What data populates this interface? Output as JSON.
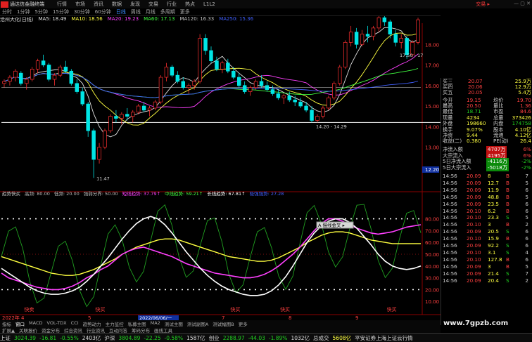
{
  "titlebar": {
    "app": "通达信金融终端",
    "menus": [
      "行情",
      "市场",
      "资讯",
      "数据",
      "发现",
      "交易",
      "行业",
      "热点",
      "L1L2"
    ],
    "trade": "交易 ▸",
    "window_buttons": "— ▢ ✕"
  },
  "periods": [
    "分时",
    "1分钟",
    "5分钟",
    "15分钟",
    "30分钟",
    "60分钟",
    "日线",
    "周线",
    "月线",
    "多周期",
    "更多"
  ],
  "active_period": "日线",
  "stock_name": "沧州大化(日线)",
  "ma_legend": [
    {
      "text": "MA5: 18.49",
      "color": "#e0e0e0"
    },
    {
      "text": "MA10: 18.56",
      "color": "#ffff40"
    },
    {
      "text": "MA20: 19.23",
      "color": "#ff40ff"
    },
    {
      "text": "MA60: 17.13",
      "color": "#40ff40"
    },
    {
      "text": "MA120: 16.33",
      "color": "#c0c0c0"
    },
    {
      "text": "MA250: 15.36",
      "color": "#4060ff"
    }
  ],
  "price_axis": [
    "18.00",
    "17.00",
    "16.00",
    "15.00",
    "14.00",
    "13.00",
    "12.20"
  ],
  "price_annotations": {
    "high": "17.50 - 17",
    "mid": "14.20 - 14.29",
    "low": "11.47"
  },
  "indicator_legend": {
    "name": "趋势快买",
    "items": [
      {
        "text": "高频: 80.00",
        "color": "#bbbbbb"
      },
      {
        "text": "低频: 20.00",
        "color": "#bbbbbb"
      },
      {
        "text": "强弱分界: 50.00",
        "color": "#bbbbbb"
      },
      {
        "text": "短线趋势: 37.79↑",
        "color": "#ff40ff"
      },
      {
        "text": "中线趋势: 59.21↑",
        "color": "#40ff40"
      },
      {
        "text": "长线趋势: 67.81↑",
        "color": "#ffffff"
      },
      {
        "text": "极强强势: 27.28",
        "color": "#4060ff"
      }
    ]
  },
  "indicator_axis": [
    "80.00",
    "70.00",
    "60.00",
    "50.00",
    "40.00",
    "30.00",
    "20.00",
    "10.00"
  ],
  "indicator_labels": {
    "buy": "快买",
    "sell": "快卖",
    "tooltip": "A 慢线金叉 ▸"
  },
  "date_axis": {
    "start": "2022年",
    "marker": "2022/06/06/一",
    "ticks": [
      "4",
      "5",
      "6",
      "7",
      "8",
      "9"
    ]
  },
  "quote": {
    "ask_rows": [
      {
        "label": "买三",
        "price": "20.07",
        "vol": "25.9万"
      },
      {
        "label": "买四",
        "price": "20.06",
        "vol": "12.9万"
      },
      {
        "label": "买五",
        "price": "20.05",
        "vol": "5.4万"
      }
    ],
    "stats": [
      {
        "l1": "今开",
        "v1": "19.15",
        "l2": "均价",
        "v2": "19.70"
      },
      {
        "l1": "最高",
        "v1": "20.50",
        "l2": "量比",
        "v2": "1.36"
      },
      {
        "l1": "最低",
        "v1": "18.71",
        "l2": "市盈",
        "v2": "84.6"
      },
      {
        "l1": "现量",
        "v1": "4234",
        "l2": "总量",
        "v2": "373426"
      },
      {
        "l1": "外盘",
        "v1": "198660",
        "l2": "内盘",
        "v2": "174758"
      },
      {
        "l1": "换手",
        "v1": "9.07%",
        "l2": "股本",
        "v2": "4.10亿"
      },
      {
        "l1": "净资",
        "v1": "9.44",
        "l2": "流通",
        "v2": "4.12亿"
      },
      {
        "l1": "收益(二)",
        "v1": "0.380",
        "l2": "PE(动)",
        "v2": "26.4"
      }
    ],
    "flows": [
      {
        "label": "净流入额",
        "value": "4707万",
        "pct": "6%"
      },
      {
        "label": "大宗流入",
        "value": "4195万",
        "pct": "6%"
      },
      {
        "label": "5日净流入额",
        "value": "-4116万",
        "pct": "-2%"
      },
      {
        "label": "5日大宗流入",
        "value": "-5018万",
        "pct": "-2%"
      }
    ]
  },
  "ticks": [
    {
      "time": "14:56",
      "price": "20.09",
      "vol": "8",
      "side": "B",
      "n": "7"
    },
    {
      "time": "14:56",
      "price": "20.09",
      "vol": "12.7",
      "side": "B",
      "n": "5"
    },
    {
      "time": "14:56",
      "price": "20.09",
      "vol": "11.9",
      "side": "B",
      "n": "6"
    },
    {
      "time": "14:56",
      "price": "20.09",
      "vol": "48.8",
      "side": "B",
      "n": "5"
    },
    {
      "time": "14:56",
      "price": "20.09",
      "vol": "23.5",
      "side": "B",
      "n": "6"
    },
    {
      "time": "14:56",
      "price": "20.10",
      "vol": "6.2",
      "side": "B",
      "n": "6"
    },
    {
      "time": "14:56",
      "price": "20.10",
      "vol": "23.3",
      "side": "S",
      "n": "5"
    },
    {
      "time": "14:56",
      "price": "20.10",
      "vol": "3",
      "side": "B",
      "n": "2"
    },
    {
      "time": "14:56",
      "price": "20.09",
      "vol": "20.5",
      "side": "S",
      "n": "6"
    },
    {
      "time": "14:56",
      "price": "20.10",
      "vol": "15.9",
      "side": "B",
      "n": "6"
    },
    {
      "time": "14:56",
      "price": "20.09",
      "vol": "92.2",
      "side": "S",
      "n": "6"
    },
    {
      "time": "14:56",
      "price": "20.10",
      "vol": "3.1",
      "side": "S",
      "n": "4"
    },
    {
      "time": "14:56",
      "price": "20.10",
      "vol": "127.8",
      "side": "B",
      "n": "6"
    },
    {
      "time": "14:56",
      "price": "20.09",
      "vol": "3",
      "side": "B",
      "n": "5"
    },
    {
      "time": "14:56",
      "price": "20.09",
      "vol": "21.4",
      "side": "S",
      "n": "7"
    },
    {
      "time": "14:56",
      "price": "20.09",
      "vol": "20.4",
      "side": "S",
      "n": "2"
    }
  ],
  "bottom_tabs": [
    "指标",
    "窗口",
    "MACD",
    "VOL-TDX",
    "CCI",
    "趋势动力",
    "主力监控",
    "私募主图",
    "MA2",
    "测试主图",
    "测试副图A",
    "测试幅图B",
    "更多"
  ],
  "bottom_tabs2": [
    "扩展▲",
    "关联报价",
    "资金分布",
    "综合资讯",
    "行业资讯",
    "互动问答",
    "筹码分布",
    "画线工具"
  ],
  "status": {
    "sh_label": "上证",
    "sh_val": "3024.39",
    "sh_chg": "-16.81",
    "sh_pct": "-0.55%",
    "sh_amt": "2403亿",
    "sz_label": "沪深",
    "sz_val": "3804.89",
    "sz_chg": "-22.25",
    "sz_pct": "-0.58%",
    "sz_amt": "1587亿",
    "cy_label": "创业",
    "cy_val": "2288.97",
    "cy_chg": "-44.03",
    "cy_pct": "-1.89%",
    "cy_amt": "1032亿",
    "total_label": "总成交",
    "total_val": "5608亿",
    "msg": "平安证券上海上证云行情"
  },
  "watermark": "www.7gpzb.com",
  "colors": {
    "up": "#ff3030",
    "down": "#00e5e5",
    "ma5": "#e0e0e0",
    "ma10": "#ffff40",
    "ma20": "#ff40ff",
    "ma60": "#40ff40",
    "ma120": "#c0c0c0",
    "ma250": "#4060ff"
  },
  "chart_data": {
    "type": "candlestick",
    "candles": [
      [
        16.1,
        16.3,
        15.9,
        16.2
      ],
      [
        16.2,
        16.5,
        16.0,
        16.4
      ],
      [
        16.4,
        16.8,
        16.2,
        16.7
      ],
      [
        16.6,
        16.7,
        16.0,
        16.1
      ],
      [
        16.1,
        16.4,
        15.8,
        16.3
      ],
      [
        16.3,
        16.9,
        16.2,
        16.8
      ],
      [
        16.8,
        17.3,
        16.6,
        17.2
      ],
      [
        17.2,
        17.5,
        16.9,
        17.0
      ],
      [
        17.0,
        17.1,
        16.2,
        16.3
      ],
      [
        16.3,
        16.6,
        16.0,
        16.5
      ],
      [
        16.5,
        17.0,
        16.4,
        16.9
      ],
      [
        16.9,
        17.2,
        16.6,
        16.7
      ],
      [
        16.7,
        16.8,
        16.0,
        16.1
      ],
      [
        16.1,
        16.3,
        15.6,
        15.7
      ],
      [
        15.7,
        15.9,
        15.0,
        15.1
      ],
      [
        15.1,
        15.2,
        13.5,
        13.8
      ],
      [
        13.8,
        13.9,
        11.5,
        12.4
      ],
      [
        12.4,
        13.2,
        12.2,
        13.0
      ],
      [
        13.0,
        13.9,
        12.9,
        13.8
      ],
      [
        13.8,
        14.6,
        13.7,
        14.5
      ],
      [
        14.5,
        14.8,
        14.2,
        14.4
      ],
      [
        14.4,
        14.7,
        14.1,
        14.6
      ],
      [
        14.6,
        14.9,
        14.3,
        14.5
      ],
      [
        14.5,
        14.8,
        14.2,
        14.7
      ],
      [
        14.7,
        15.1,
        14.6,
        15.0
      ],
      [
        15.0,
        15.2,
        14.7,
        14.8
      ],
      [
        14.8,
        15.0,
        14.5,
        14.9
      ],
      [
        14.9,
        15.3,
        14.8,
        15.2
      ],
      [
        15.2,
        16.5,
        15.1,
        16.4
      ],
      [
        16.4,
        17.1,
        16.2,
        16.9
      ],
      [
        16.9,
        17.0,
        16.4,
        16.5
      ],
      [
        16.5,
        16.7,
        16.1,
        16.2
      ],
      [
        16.2,
        16.4,
        15.8,
        15.9
      ],
      [
        15.9,
        16.1,
        15.6,
        16.0
      ],
      [
        16.0,
        16.3,
        15.8,
        16.2
      ],
      [
        16.2,
        18.5,
        16.1,
        18.3
      ],
      [
        18.3,
        18.5,
        17.5,
        17.7
      ],
      [
        17.7,
        17.9,
        17.1,
        17.2
      ],
      [
        17.2,
        17.4,
        16.7,
        16.8
      ],
      [
        16.8,
        17.2,
        16.6,
        17.1
      ],
      [
        17.1,
        17.3,
        16.6,
        16.7
      ],
      [
        16.7,
        16.9,
        16.3,
        16.4
      ],
      [
        16.4,
        16.6,
        15.9,
        16.0
      ],
      [
        16.0,
        16.2,
        15.6,
        15.7
      ],
      [
        15.7,
        16.0,
        15.5,
        15.9
      ],
      [
        15.9,
        16.3,
        15.8,
        16.2
      ],
      [
        16.2,
        16.5,
        15.9,
        16.0
      ],
      [
        16.0,
        16.2,
        15.7,
        15.8
      ],
      [
        15.8,
        16.0,
        15.5,
        15.6
      ],
      [
        15.6,
        15.8,
        15.3,
        15.4
      ],
      [
        15.4,
        15.6,
        15.1,
        15.5
      ],
      [
        15.5,
        15.7,
        15.2,
        15.3
      ],
      [
        15.3,
        15.5,
        15.0,
        15.2
      ],
      [
        15.2,
        15.4,
        14.9,
        15.0
      ],
      [
        15.0,
        15.2,
        14.7,
        14.8
      ],
      [
        14.8,
        15.0,
        14.2,
        14.3
      ],
      [
        14.3,
        14.6,
        14.2,
        14.5
      ],
      [
        14.5,
        15.0,
        14.4,
        14.9
      ],
      [
        14.9,
        15.5,
        14.8,
        15.4
      ],
      [
        15.4,
        16.2,
        15.3,
        16.1
      ],
      [
        16.1,
        17.0,
        16.0,
        16.9
      ],
      [
        16.9,
        18.2,
        16.8,
        18.1
      ],
      [
        18.1,
        18.9,
        17.9,
        18.6
      ],
      [
        18.6,
        18.8,
        17.8,
        18.0
      ],
      [
        18.0,
        18.7,
        17.9,
        18.5
      ],
      [
        18.5,
        18.9,
        18.1,
        18.4
      ],
      [
        18.4,
        18.9,
        18.2,
        18.8
      ],
      [
        18.8,
        19.5,
        18.6,
        19.3
      ],
      [
        19.3,
        19.8,
        18.9,
        19.1
      ],
      [
        19.1,
        19.2,
        18.3,
        18.5
      ],
      [
        18.5,
        18.7,
        17.9,
        18.1
      ],
      [
        18.1,
        18.5,
        17.8,
        18.3
      ],
      [
        18.3,
        18.4,
        17.3,
        17.5
      ],
      [
        17.5,
        18.2,
        17.4,
        18.1
      ],
      [
        18.1,
        19.3,
        18.0,
        19.2
      ]
    ],
    "ylim": [
      11,
      19
    ],
    "indicator": {
      "short": [
        34,
        30,
        28,
        26,
        24,
        22,
        21,
        20,
        20,
        21,
        23,
        26,
        30,
        33,
        37,
        40,
        45,
        50,
        53,
        55,
        56,
        54,
        52,
        50,
        48,
        45,
        42,
        40,
        38,
        36,
        34,
        33,
        32,
        31,
        30,
        30,
        31,
        33,
        36,
        40,
        45,
        50,
        56,
        63,
        70,
        76,
        80,
        80,
        78,
        75,
        72,
        70,
        68,
        67,
        68,
        69,
        71,
        73,
        74,
        75
      ],
      "mid": [
        48,
        46,
        44,
        42,
        40,
        38,
        36,
        34,
        33,
        32,
        32,
        33,
        35,
        37,
        40,
        43,
        46,
        50,
        53,
        56,
        58,
        60,
        62,
        63,
        63,
        62,
        60,
        58,
        56,
        54,
        52,
        50,
        48,
        47,
        46,
        45,
        44,
        44,
        45,
        47,
        50,
        53,
        56,
        60,
        63,
        66,
        68,
        69,
        69,
        68,
        66,
        64,
        62,
        61,
        60,
        59,
        59,
        59,
        59,
        59
      ],
      "long": [
        38,
        34,
        30,
        26,
        22,
        19,
        17,
        16,
        16,
        17,
        19,
        22,
        27,
        33,
        40,
        47,
        55,
        63,
        70,
        76,
        80,
        82,
        80,
        75,
        68,
        60,
        52,
        45,
        38,
        32,
        27,
        23,
        20,
        18,
        16,
        15,
        15,
        16,
        19,
        24,
        31,
        40,
        50,
        60,
        68,
        74,
        78,
        80,
        80,
        77,
        72,
        65,
        58,
        50,
        44,
        40,
        38,
        37,
        38,
        40
      ]
    }
  }
}
